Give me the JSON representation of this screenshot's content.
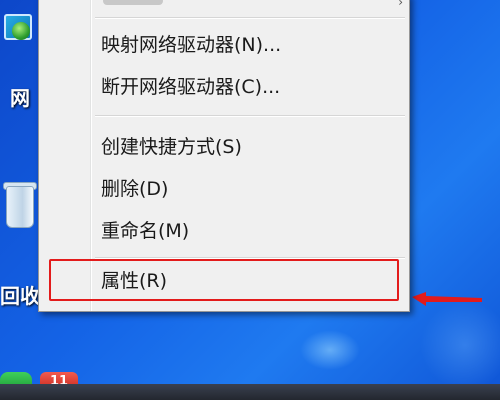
{
  "desktop": {
    "network_icon_label": "网",
    "recycle_bin_label": "回收",
    "bottom_badge": "11"
  },
  "context_menu": {
    "items": [
      {
        "label": "映射网络驱动器(N)..."
      },
      {
        "label": "断开网络驱动器(C)..."
      },
      {
        "label": "创建快捷方式(S)"
      },
      {
        "label": "删除(D)"
      },
      {
        "label": "重命名(M)"
      },
      {
        "label": "属性(R)"
      }
    ],
    "highlighted_item": "属性(R)"
  },
  "annotation": {
    "highlight_color": "#e31b1b",
    "arrow_color": "#e31b1b"
  }
}
